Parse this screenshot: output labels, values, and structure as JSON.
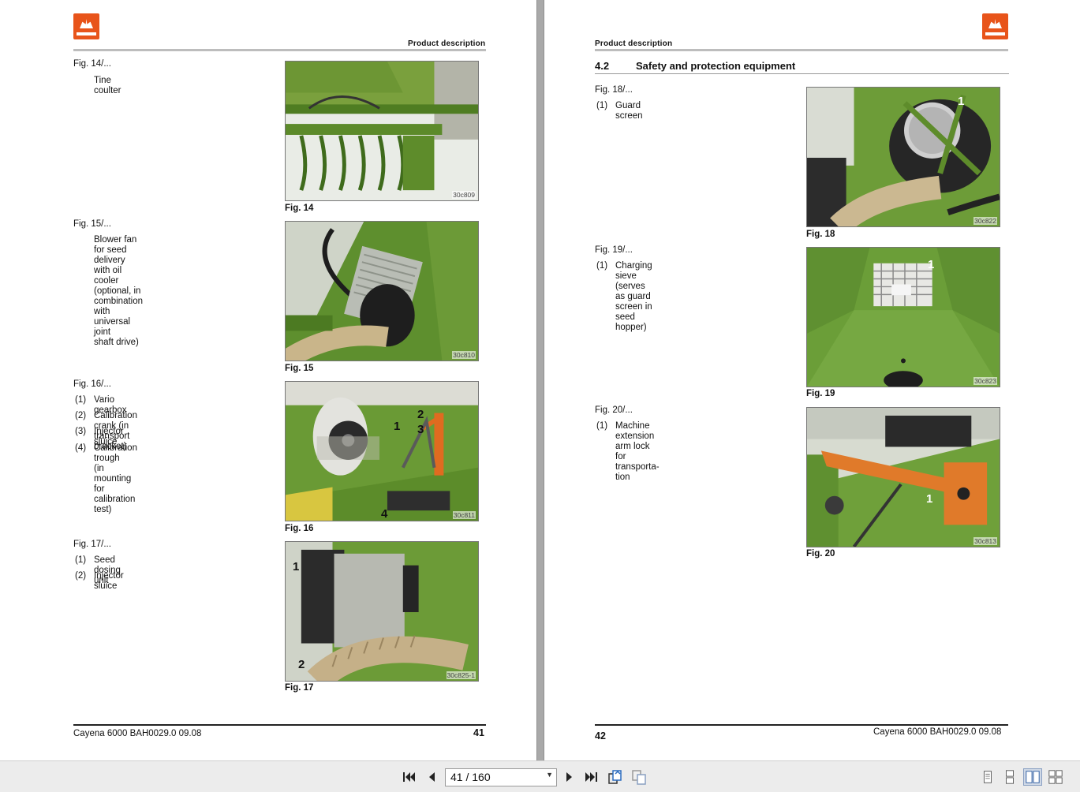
{
  "left_page": {
    "header_title": "Product description",
    "figures": [
      {
        "ref": "Fig. 14/...",
        "items": [
          {
            "num": "",
            "text": "Tine coulter"
          }
        ],
        "caption": "Fig. 14",
        "code": "30c809"
      },
      {
        "ref": "Fig. 15/...",
        "items": [
          {
            "num": "",
            "text": "Blower fan for seed delivery with oil cooler\n(optional, in combination with universal joint\nshaft drive)"
          }
        ],
        "caption": "Fig. 15",
        "code": "30c810"
      },
      {
        "ref": "Fig. 16/...",
        "items": [
          {
            "num": "(1)",
            "text": "Vario gearbox"
          },
          {
            "num": "(2)",
            "text": "Calibration crank (in transport bracket)"
          },
          {
            "num": "(3)",
            "text": "Injector sluice"
          },
          {
            "num": "(4)",
            "text": "Calibration trough\n(in mounting for calibration test)"
          }
        ],
        "caption": "Fig. 16",
        "code": "30c811",
        "labels": [
          "1",
          "2",
          "3",
          "4"
        ]
      },
      {
        "ref": "Fig. 17/...",
        "items": [
          {
            "num": "(1)",
            "text": "Seed dosing unit"
          },
          {
            "num": "(2)",
            "text": "Injector sluice"
          }
        ],
        "caption": "Fig. 17",
        "code": "30c825-1",
        "labels": [
          "1",
          "2"
        ]
      }
    ],
    "footer_text": "Cayena 6000  BAH0029.0  09.08",
    "page_number": "41"
  },
  "right_page": {
    "header_title": "Product description",
    "section_number": "4.2",
    "section_title": "Safety and protection equipment",
    "figures": [
      {
        "ref": "Fig. 18/...",
        "items": [
          {
            "num": "(1)",
            "text": "Guard screen"
          }
        ],
        "caption": "Fig. 18",
        "code": "30c822",
        "labels": [
          "1"
        ]
      },
      {
        "ref": "Fig. 19/...",
        "items": [
          {
            "num": "(1)",
            "text": "Charging sieve\n(serves as guard screen in seed hopper)"
          }
        ],
        "caption": "Fig. 19",
        "code": "30c823",
        "labels": [
          "1"
        ]
      },
      {
        "ref": "Fig. 20/...",
        "items": [
          {
            "num": "(1)",
            "text": "Machine extension arm lock for transporta-\ntion"
          }
        ],
        "caption": "Fig. 20",
        "code": "30c813",
        "labels": [
          "1"
        ]
      }
    ],
    "footer_text": "Cayena 6000  BAH0029.0  09.08",
    "page_number": "42"
  },
  "toolbar": {
    "page_indicator": "41 / 160",
    "icons": [
      "first-page-icon",
      "prev-page-icon",
      "next-page-icon",
      "last-page-icon",
      "rotate-icon",
      "copy-icon",
      "single-page-view-icon",
      "continuous-view-icon",
      "two-page-view-icon",
      "continuous-two-page-view-icon"
    ],
    "active_view": "two-page-view"
  },
  "colors": {
    "brand_orange": "#e8541a",
    "machine_green": "#5a8a2c",
    "toolbar_bg": "#ececec"
  }
}
